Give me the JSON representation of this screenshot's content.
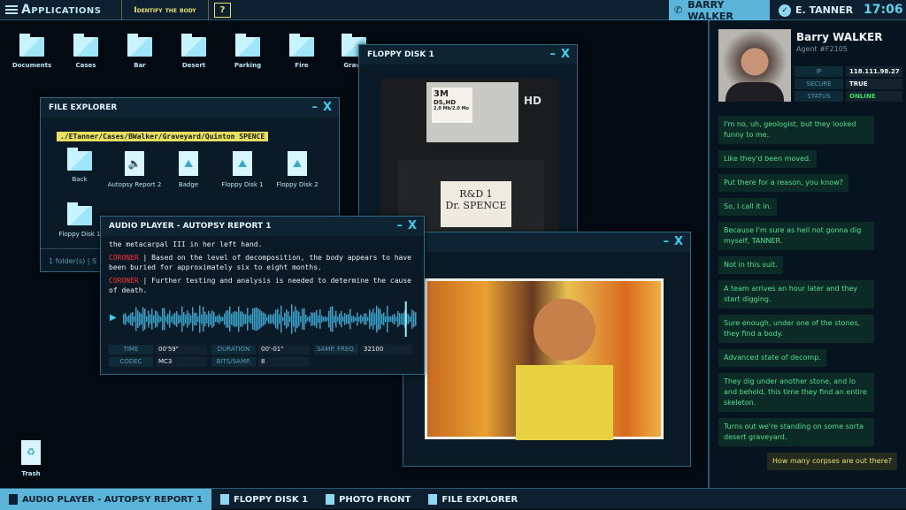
{
  "topbar": {
    "apps_label": "Applications",
    "mission": "Identify the body",
    "help": "?",
    "call_label": "BARRY WALKER",
    "user_label": "E. TANNER",
    "clock": "17:06"
  },
  "desktop": {
    "icons": [
      {
        "label": "Documents"
      },
      {
        "label": "Cases"
      },
      {
        "label": "Bar"
      },
      {
        "label": "Desert"
      },
      {
        "label": "Parking"
      },
      {
        "label": "Fire"
      },
      {
        "label": "Grave"
      }
    ],
    "trash": "Trash"
  },
  "file_explorer": {
    "title": "FILE EXPLORER",
    "path": "./ETanner/Cases/BWalker/Graveyard/Quinton SPENCE",
    "items": [
      {
        "label": "Back"
      },
      {
        "label": "Autopsy Report 2"
      },
      {
        "label": "Badge"
      },
      {
        "label": "Floppy Disk 1"
      },
      {
        "label": "Floppy Disk 2"
      },
      {
        "label": "Floppy Disk 1"
      }
    ],
    "status": "1 folder(s)  |  S"
  },
  "floppy": {
    "title": "FLOPPY DISK 1",
    "brand": "3M",
    "type": "DS,HD",
    "cap": "2.0 Mb/2.0 Mo",
    "hd": "HD",
    "label1": "R&D 1",
    "label2": "Dr. SPENCE"
  },
  "photo": {
    "title": ""
  },
  "audio": {
    "title": "AUDIO PLAYER - AUTOPSY REPORT 1",
    "line0": "the metacarpal III in her left hand.",
    "speaker": "CORONER",
    "line1": "Based on the level of decomposition, the body appears to have been buried for approximately six to eight months.",
    "line2": "Further testing and analysis is needed to determine the cause of death.",
    "progress": 0.96,
    "meta": {
      "time_l": "TIME",
      "time": "00'59\"",
      "dur_l": "DURATION",
      "dur": "00'-01\"",
      "freq_l": "SAMP. FREQ.",
      "freq": "32100",
      "codec_l": "CODEC",
      "codec": "MC3",
      "bits_l": "BITS/SAMP.",
      "bits": "8"
    }
  },
  "contact": {
    "name": "Barry WALKER",
    "agent": "Agent #F2105",
    "ip_l": "IP",
    "ip": "118.111.98.27",
    "secure_l": "SECURE",
    "secure": "TRUE",
    "status_l": "STATUS",
    "status": "ONLINE"
  },
  "messages": [
    {
      "text": "I'm no, uh, geologist, but they looked funny to me."
    },
    {
      "text": "Like they'd been moved."
    },
    {
      "text": "Put there for a reason, you know?"
    },
    {
      "text": "So, I call it in."
    },
    {
      "text": "Because I'm sure as hell not gonna dig myself, TANNER."
    },
    {
      "text": "Not in this suit."
    },
    {
      "text": "A team arrives an hour later and they start digging."
    },
    {
      "text": "Sure enough, under one of the stones, they find a body."
    },
    {
      "text": "Advanced state of decomp."
    },
    {
      "text": "They dig under another stone, and lo and behold, this time they find an entire skeleton."
    },
    {
      "text": "Turns out we're standing on some sorta desert graveyard."
    },
    {
      "text": "How many corpses are out there?"
    }
  ],
  "taskbar": [
    "AUDIO PLAYER - AUTOPSY REPORT 1",
    "FLOPPY DISK 1",
    "PHOTO FRONT",
    "FILE EXPLORER"
  ],
  "colors": {
    "accent": "#5ab5d8",
    "mission": "#e8e070",
    "online": "#30e060",
    "coroner": "#ff3030",
    "chat": "#4fe090"
  }
}
